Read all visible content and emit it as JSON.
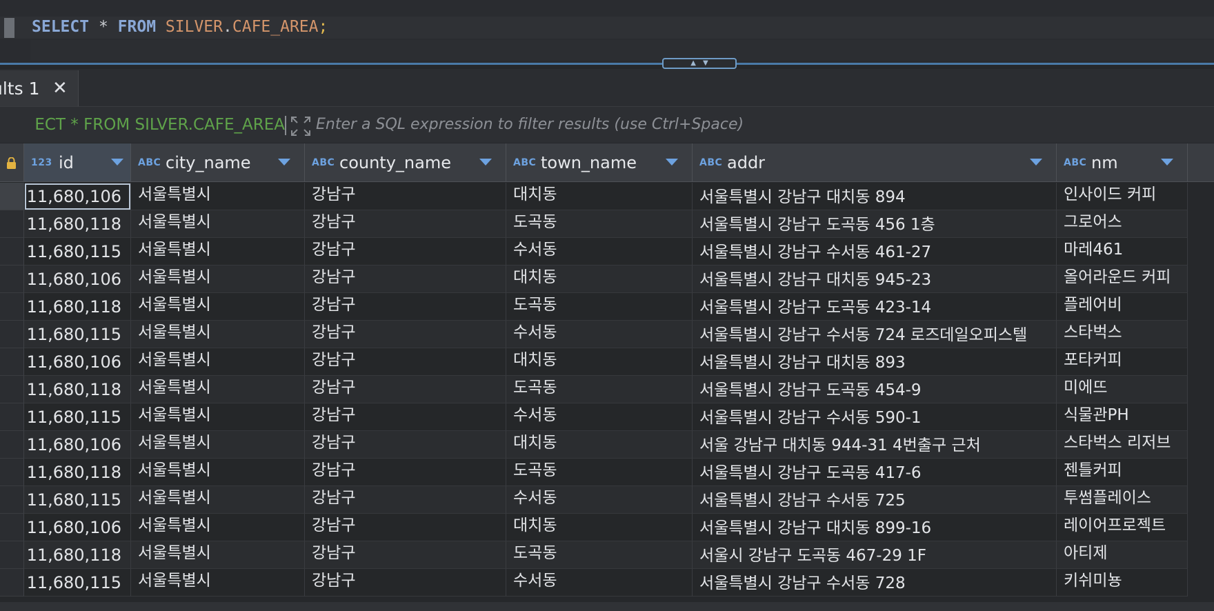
{
  "editor": {
    "sql": {
      "kw1": "SELECT",
      "star": "*",
      "kw2": "FROM",
      "schema": "SILVER",
      "dot": ".",
      "table": "CAFE_AREA",
      "semi": ";"
    }
  },
  "results_tab": {
    "label": "ults 1",
    "close_glyph": "✕"
  },
  "filter": {
    "query": "ECT * FROM SILVER.CAFE_AREA",
    "placeholder": "Enter a SQL expression to filter results (use Ctrl+Space)"
  },
  "columns": [
    {
      "type": "123",
      "name": "id"
    },
    {
      "type": "ABC",
      "name": "city_name"
    },
    {
      "type": "ABC",
      "name": "county_name"
    },
    {
      "type": "ABC",
      "name": "town_name"
    },
    {
      "type": "ABC",
      "name": "addr"
    },
    {
      "type": "ABC",
      "name": "nm"
    }
  ],
  "rows": [
    [
      "11,680,106",
      "서울특별시",
      "강남구",
      "대치동",
      "서울특별시 강남구 대치동 894",
      "인사이드 커피"
    ],
    [
      "11,680,118",
      "서울특별시",
      "강남구",
      "도곡동",
      "서울특별시 강남구 도곡동 456 1층",
      "그로어스"
    ],
    [
      "11,680,115",
      "서울특별시",
      "강남구",
      "수서동",
      "서울특별시 강남구 수서동 461-27",
      "마레461"
    ],
    [
      "11,680,106",
      "서울특별시",
      "강남구",
      "대치동",
      "서울특별시 강남구 대치동 945-23",
      "올어라운드 커피"
    ],
    [
      "11,680,118",
      "서울특별시",
      "강남구",
      "도곡동",
      "서울특별시 강남구 도곡동 423-14",
      "플레어비"
    ],
    [
      "11,680,115",
      "서울특별시",
      "강남구",
      "수서동",
      "서울특별시 강남구 수서동 724 로즈데일오피스텔",
      "스타벅스"
    ],
    [
      "11,680,106",
      "서울특별시",
      "강남구",
      "대치동",
      "서울특별시 강남구 대치동 893",
      "포타커피"
    ],
    [
      "11,680,118",
      "서울특별시",
      "강남구",
      "도곡동",
      "서울특별시 강남구 도곡동 454-9",
      "미에뜨"
    ],
    [
      "11,680,115",
      "서울특별시",
      "강남구",
      "수서동",
      "서울특별시 강남구 수서동 590-1",
      "식물관PH"
    ],
    [
      "11,680,106",
      "서울특별시",
      "강남구",
      "대치동",
      "서울 강남구 대치동 944-31 4번출구 근처",
      "스타벅스 리저브"
    ],
    [
      "11,680,118",
      "서울특별시",
      "강남구",
      "도곡동",
      "서울특별시 강남구 도곡동 417-6",
      "젠틀커피"
    ],
    [
      "11,680,115",
      "서울특별시",
      "강남구",
      "수서동",
      "서울특별시 강남구 수서동 725",
      "투썸플레이스"
    ],
    [
      "11,680,106",
      "서울특별시",
      "강남구",
      "대치동",
      "서울특별시 강남구 대치동 899-16",
      "레이어프로젝트"
    ],
    [
      "11,680,118",
      "서울특별시",
      "강남구",
      "도곡동",
      "서울시 강남구 도곡동 467-29 1F",
      "아티제"
    ],
    [
      "11,680,115",
      "서울특별시",
      "강남구",
      "수서동",
      "서울특별시 강남구 수서동 728",
      "키쉬미뇽"
    ]
  ],
  "colors": {
    "accent": "#6da2e0",
    "filter_query": "#5fa34a",
    "keyword": "#8aa8d6",
    "identifier": "#d4956b"
  },
  "icons": {
    "lock": "lock-icon",
    "expand": "expand-icon",
    "close": "close-icon",
    "sort": "sort-arrow-icon"
  }
}
